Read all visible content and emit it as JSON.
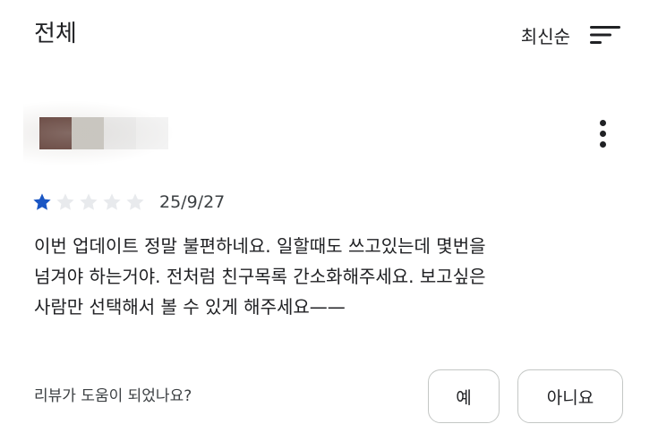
{
  "header": {
    "title": "전체",
    "sort_label": "최신순",
    "sort_icon": "sort-lines-icon"
  },
  "review": {
    "avatar_icon": "blurred-avatar",
    "more_icon": "more-vert-icon",
    "rating": 1,
    "rating_max": 5,
    "star_colors": {
      "filled": "#1a56c4",
      "empty": "#e8eaed"
    },
    "date": "25/9/27",
    "text_lines": [
      "이번 업데이트 정말 불편하네요. 일할때도 쓰고있는데 몇번을",
      "넘겨야 하는거야. 전처럼 친구목록 간소화해주세요. 보고싶은",
      "사람만 선택해서 볼 수 있게 해주세요——"
    ]
  },
  "helpful": {
    "question": "리뷰가 도움이 되었나요?",
    "yes_label": "예",
    "no_label": "아니요"
  }
}
